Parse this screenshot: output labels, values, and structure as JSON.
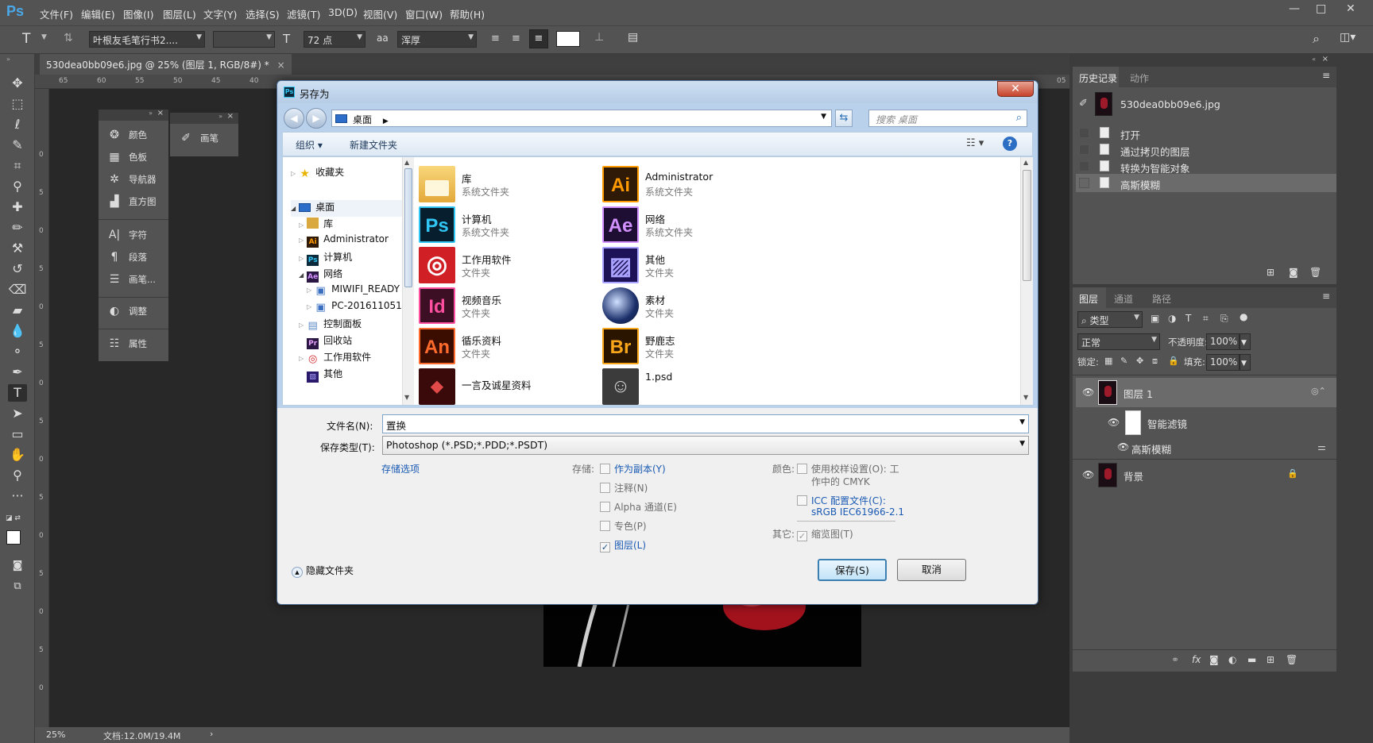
{
  "app": {
    "logo": "Ps",
    "menus": [
      "文件(F)",
      "编辑(E)",
      "图像(I)",
      "图层(L)",
      "文字(Y)",
      "选择(S)",
      "滤镜(T)",
      "3D(D)",
      "视图(V)",
      "窗口(W)",
      "帮助(H)"
    ],
    "window_controls": [
      "—",
      "□",
      "✕"
    ]
  },
  "options_bar": {
    "tool_glyph": "T",
    "font_family": "叶根友毛笔行书2....",
    "font_size": "72 点",
    "aa_label": "aa",
    "antialias": "浑厚",
    "text_color": "#ffffff"
  },
  "document": {
    "tab_title": "530dea0bb09e6.jpg @ 25% (图层 1, RGB/8#) *",
    "tab_close": "×",
    "ruler_top": [
      "65",
      "60",
      "55",
      "50",
      "45",
      "40"
    ],
    "ruler_right": "05",
    "ruler_left": [
      "0",
      "5",
      "0",
      "5",
      "0",
      "5",
      "0",
      "5",
      "0",
      "5",
      "0",
      "5",
      "0",
      "5",
      "0",
      "5",
      "0",
      "5",
      "0"
    ],
    "zoom": "25%",
    "doc_info": "文档:12.0M/19.4M",
    "status_arrow": "›"
  },
  "float_panels": {
    "group1": [
      {
        "icon": "palette-icon",
        "glyph": "❂",
        "label": "颜色"
      },
      {
        "icon": "swatches-icon",
        "glyph": "▦",
        "label": "色板"
      },
      {
        "icon": "navigator-icon",
        "glyph": "✲",
        "label": "导航器"
      },
      {
        "icon": "histogram-icon",
        "glyph": "▟",
        "label": "直方图"
      },
      {
        "icon": "character-icon",
        "glyph": "A|",
        "label": "字符"
      },
      {
        "icon": "paragraph-icon",
        "glyph": "¶",
        "label": "段落"
      },
      {
        "icon": "brush-presets-icon",
        "glyph": "☰",
        "label": "画笔..."
      },
      {
        "icon": "adjustments-icon",
        "glyph": "◐",
        "label": "调整"
      },
      {
        "icon": "properties-icon",
        "glyph": "☷",
        "label": "属性"
      }
    ],
    "group2": [
      {
        "icon": "brush-icon",
        "glyph": "✐",
        "label": "画笔"
      }
    ]
  },
  "history_panel": {
    "tabs": [
      "历史记录",
      "动作"
    ],
    "snapshot": "530dea0bb09e6.jpg",
    "states": [
      "打开",
      "通过拷贝的图层",
      "转换为智能对象",
      "高斯模糊"
    ],
    "selected_index": 3
  },
  "layers_panel": {
    "tabs": [
      "图层",
      "通道",
      "路径"
    ],
    "filter_kind": "类型",
    "blend_mode": "正常",
    "opacity_label": "不透明度:",
    "opacity": "100%",
    "lock_label": "锁定:",
    "fill_label": "填充:",
    "fill": "100%",
    "layers": [
      {
        "name": "图层 1"
      },
      {
        "name": "智能滤镜"
      },
      {
        "name": "高斯模糊"
      },
      {
        "name": "背景"
      }
    ]
  },
  "dialog": {
    "title": "另存为",
    "close": "✕",
    "address": "桌面",
    "search_placeholder": "搜索 桌面",
    "organize": "组织 ▾",
    "new_folder": "新建文件夹",
    "help": "?",
    "nav": [
      {
        "label": "收藏夹",
        "icon": "star-icon",
        "glyph": "★",
        "color": "#e8b400",
        "indent": 0
      },
      {
        "label": "桌面",
        "icon": "desktop-icon",
        "glyph": "",
        "color": "#2c6dc9",
        "indent": 0
      },
      {
        "label": "库",
        "icon": "library-icon",
        "glyph": "",
        "color": "#d9a93f",
        "indent": 1
      },
      {
        "label": "Administrator",
        "icon": "ai-icon",
        "glyph": "Ai",
        "color": "#2f1a07",
        "indent": 1
      },
      {
        "label": "计算机",
        "icon": "ps-icon",
        "glyph": "Ps",
        "color": "#0b2a3b",
        "indent": 1
      },
      {
        "label": "网络",
        "icon": "ae-icon",
        "glyph": "Ae",
        "color": "#2b1743",
        "indent": 1
      },
      {
        "label": "MIWIFI_READY",
        "icon": "computer-icon",
        "glyph": "▣",
        "color": "#3a6fc0",
        "indent": 2
      },
      {
        "label": "PC-201611051",
        "icon": "computer-icon",
        "glyph": "▣",
        "color": "#3a6fc0",
        "indent": 2
      },
      {
        "label": "控制面板",
        "icon": "control-panel-icon",
        "glyph": "▤",
        "color": "#5b88c4",
        "indent": 1
      },
      {
        "label": "回收站",
        "icon": "pr-icon",
        "glyph": "Pr",
        "color": "#2b1743",
        "indent": 1
      },
      {
        "label": "工作用软件",
        "icon": "cc-icon",
        "glyph": "◎",
        "color": "#d11f26",
        "indent": 1
      },
      {
        "label": "其他",
        "icon": "media-encoder-icon",
        "glyph": "▨",
        "color": "#2b1a6b",
        "indent": 1
      }
    ],
    "files": [
      {
        "name": "库",
        "sub": "系统文件夹",
        "glyph": "",
        "icon": "library-folder-icon",
        "bg": "#f2c654",
        "fg": "#ffffff"
      },
      {
        "name": "Administrator",
        "sub": "系统文件夹",
        "glyph": "Ai",
        "icon": "illustrator-icon",
        "bg": "#2f1a07",
        "fg": "#ff9a00"
      },
      {
        "name": "计算机",
        "sub": "系统文件夹",
        "glyph": "Ps",
        "icon": "photoshop-icon",
        "bg": "#061e2d",
        "fg": "#31c5f4"
      },
      {
        "name": "网络",
        "sub": "系统文件夹",
        "glyph": "Ae",
        "icon": "after-effects-icon",
        "bg": "#1f0e33",
        "fg": "#d291ff"
      },
      {
        "name": "工作用软件",
        "sub": "文件夹",
        "glyph": "◎",
        "icon": "creative-cloud-icon",
        "bg": "#d11f26",
        "fg": "#ffffff"
      },
      {
        "name": "其他",
        "sub": "文件夹",
        "glyph": "▨",
        "icon": "media-encoder-icon",
        "bg": "#1d1257",
        "fg": "#a9a3ff"
      },
      {
        "name": "视频音乐",
        "sub": "文件夹",
        "glyph": "Id",
        "icon": "indesign-icon",
        "bg": "#3c0f25",
        "fg": "#ff4fa0"
      },
      {
        "name": "素材",
        "sub": "文件夹",
        "glyph": "◉",
        "icon": "cinema4d-icon",
        "bg": "#1b2f6a",
        "fg": "#cfe0ff"
      },
      {
        "name": "循乐资料",
        "sub": "文件夹",
        "glyph": "An",
        "icon": "animate-icon",
        "bg": "#3a0d00",
        "fg": "#ff6b2c"
      },
      {
        "name": "野鹿志",
        "sub": "文件夹",
        "glyph": "Br",
        "icon": "bridge-icon",
        "bg": "#2a1600",
        "fg": "#f9a61a"
      },
      {
        "name": "一言及诚星资料",
        "sub": "",
        "glyph": "◆",
        "icon": "red-app-icon",
        "bg": "#3a0a0a",
        "fg": "#e24a4a"
      },
      {
        "name": "1.psd",
        "sub": "",
        "glyph": "☺",
        "icon": "psd-thumbnail-icon",
        "bg": "#3b3b3b",
        "fg": "#d6d6d6"
      }
    ],
    "filename_label": "文件名(N):",
    "filename": "置换",
    "filetype_label": "保存类型(T):",
    "filetype": "Photoshop (*.PSD;*.PDD;*.PSDT)",
    "save_options_link": "存储选项",
    "store_label": "存储:",
    "store_options": [
      {
        "label": "作为副本(Y)",
        "checked": false,
        "enabled": true
      },
      {
        "label": "注释(N)",
        "checked": false,
        "enabled": false
      },
      {
        "label": "Alpha 通道(E)",
        "checked": false,
        "enabled": false
      },
      {
        "label": "专色(P)",
        "checked": false,
        "enabled": false
      },
      {
        "label": "图层(L)",
        "checked": true,
        "enabled": true
      }
    ],
    "color_label": "颜色:",
    "proof_setup": "使用校样设置(O):  工",
    "proof_setup_line2": "作中的 CMYK",
    "icc_profile": "ICC 配置文件(C):",
    "icc_value": "sRGB IEC61966-2.1",
    "other_label": "其它:",
    "thumbnail": "缩览图(T)",
    "hide_folders": "隐藏文件夹",
    "save": "保存(S)",
    "cancel": "取消"
  }
}
